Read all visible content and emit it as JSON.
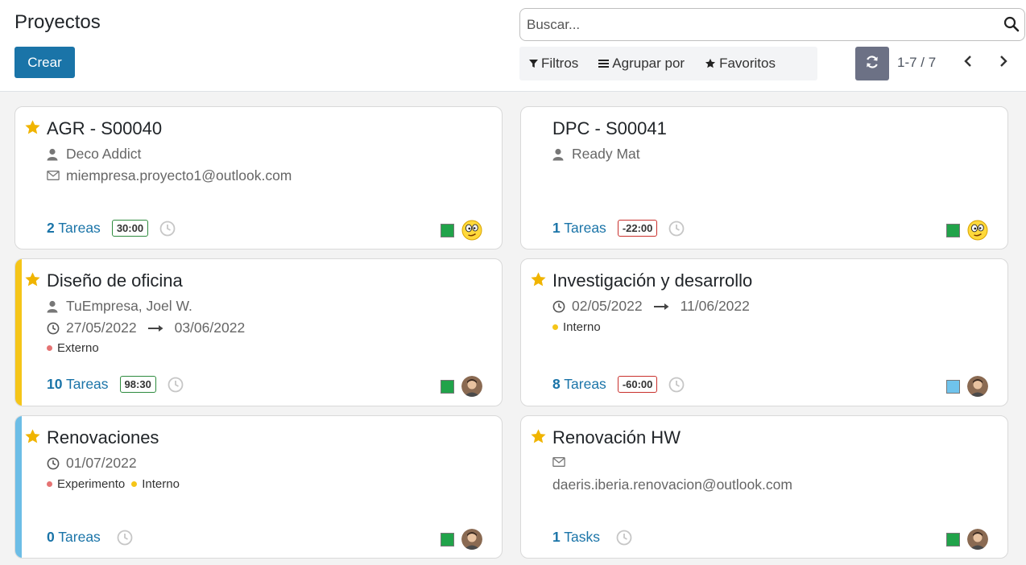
{
  "header": {
    "title": "Proyectos",
    "create_label": "Crear",
    "search_placeholder": "Buscar...",
    "filters_label": "Filtros",
    "group_by_label": "Agrupar por",
    "favorites_label": "Favoritos",
    "pager": "1-7 / 7"
  },
  "colors": {
    "primary": "#1a74a8",
    "star": "#f0b400",
    "status_green": "#21a34a",
    "status_blue": "#6fc3ec",
    "stripe_yellow": "#f5c518",
    "stripe_blue": "#6cbde6",
    "tag_red": "#e57373",
    "tag_yellow": "#f5c518"
  },
  "cards": [
    {
      "title": "AGR - S00040",
      "starred": true,
      "customer": "Deco Addict",
      "email": "miempresa.proyecto1@outlook.com",
      "tasks_count": "2",
      "tasks_label": "Tareas",
      "time": "30:00",
      "time_status": "ok",
      "status": "green",
      "avatar": "emoji"
    },
    {
      "title": "DPC - S00041",
      "starred": false,
      "customer": "Ready Mat",
      "tasks_count": "1",
      "tasks_label": "Tareas",
      "time": "-22:00",
      "time_status": "bad",
      "status": "green",
      "avatar": "emoji"
    },
    {
      "title": "Diseño de oficina",
      "starred": true,
      "stripe": "yellow",
      "customer": "TuEmpresa, Joel W.",
      "date_start": "27/05/2022",
      "date_end": "03/06/2022",
      "tags": [
        {
          "label": "Externo",
          "color": "red"
        }
      ],
      "tasks_count": "10",
      "tasks_label": "Tareas",
      "time": "98:30",
      "time_status": "ok",
      "status": "green",
      "avatar": "person"
    },
    {
      "title": "Investigación y desarrollo",
      "starred": true,
      "date_start": "02/05/2022",
      "date_end": "11/06/2022",
      "tags": [
        {
          "label": "Interno",
          "color": "yellow"
        }
      ],
      "tasks_count": "8",
      "tasks_label": "Tareas",
      "time": "-60:00",
      "time_status": "bad",
      "status": "blue",
      "avatar": "person"
    },
    {
      "title": "Renovaciones",
      "starred": true,
      "stripe": "blue",
      "date_start": "01/07/2022",
      "tags": [
        {
          "label": "Experimento",
          "color": "red"
        },
        {
          "label": "Interno",
          "color": "yellow"
        }
      ],
      "tasks_count": "0",
      "tasks_label": "Tareas",
      "status": "green",
      "avatar": "person"
    },
    {
      "title": "Renovación HW",
      "starred": true,
      "email": "daeris.iberia.renovacion@outlook.com",
      "tasks_count": "1",
      "tasks_label": "Tasks",
      "status": "green",
      "avatar": "person"
    }
  ]
}
